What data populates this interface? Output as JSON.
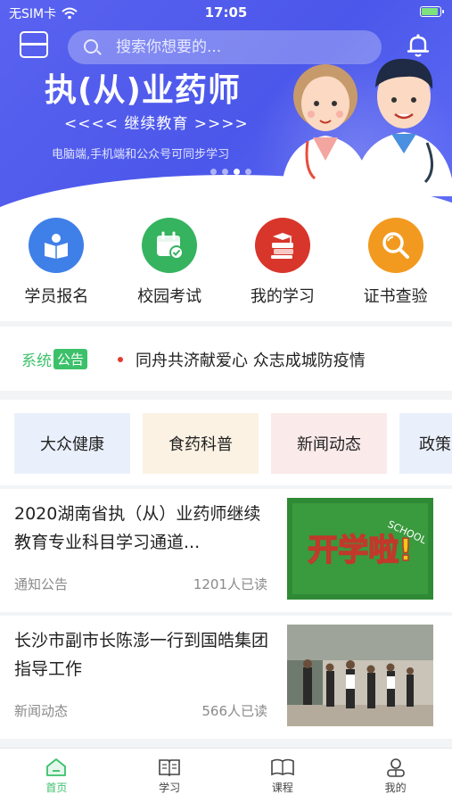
{
  "status_bar": {
    "carrier": "无SIM卡",
    "time": "17:05"
  },
  "search": {
    "placeholder": "搜索你想要的..."
  },
  "banner": {
    "title": "执(从)业药师",
    "subtitle": "<<<<  继续教育  >>>>",
    "note": "电脑端,手机端和公众号可同步学习",
    "slide_count": 4,
    "active_slide": 3
  },
  "quick_menu": [
    {
      "label": "学员报名",
      "icon": "book-reader-icon",
      "color": "#3f7fe8"
    },
    {
      "label": "校园考试",
      "icon": "calendar-check-icon",
      "color": "#35b35f"
    },
    {
      "label": "我的学习",
      "icon": "books-stack-icon",
      "color": "#d8362b"
    },
    {
      "label": "证书查验",
      "icon": "magnifier-icon",
      "color": "#f29a1f"
    }
  ],
  "notice": {
    "tag_text": "系统",
    "tag_badge": "公告",
    "text": "同舟共济献爱心 众志成城防疫情"
  },
  "categories": [
    {
      "label": "大众健康",
      "bg": "#eaf0fb"
    },
    {
      "label": "食药科普",
      "bg": "#fbf2e3"
    },
    {
      "label": "新闻动态",
      "bg": "#fbeaea"
    },
    {
      "label": "政策",
      "bg": "#eaf0fb"
    }
  ],
  "news": [
    {
      "title": "2020湖南省执（从）业药师继续教育专业科目学习通道...",
      "category": "通知公告",
      "reads": "1201人已读",
      "image_text": "开学啦!",
      "image_sub": "SCHOOL"
    },
    {
      "title": "长沙市副市长陈澎一行到国皓集团指导工作",
      "category": "新闻动态",
      "reads": "566人已读"
    }
  ],
  "tabbar": [
    {
      "label": "首页",
      "active": true
    },
    {
      "label": "学习",
      "active": false
    },
    {
      "label": "课程",
      "active": false
    },
    {
      "label": "我的",
      "active": false
    }
  ]
}
